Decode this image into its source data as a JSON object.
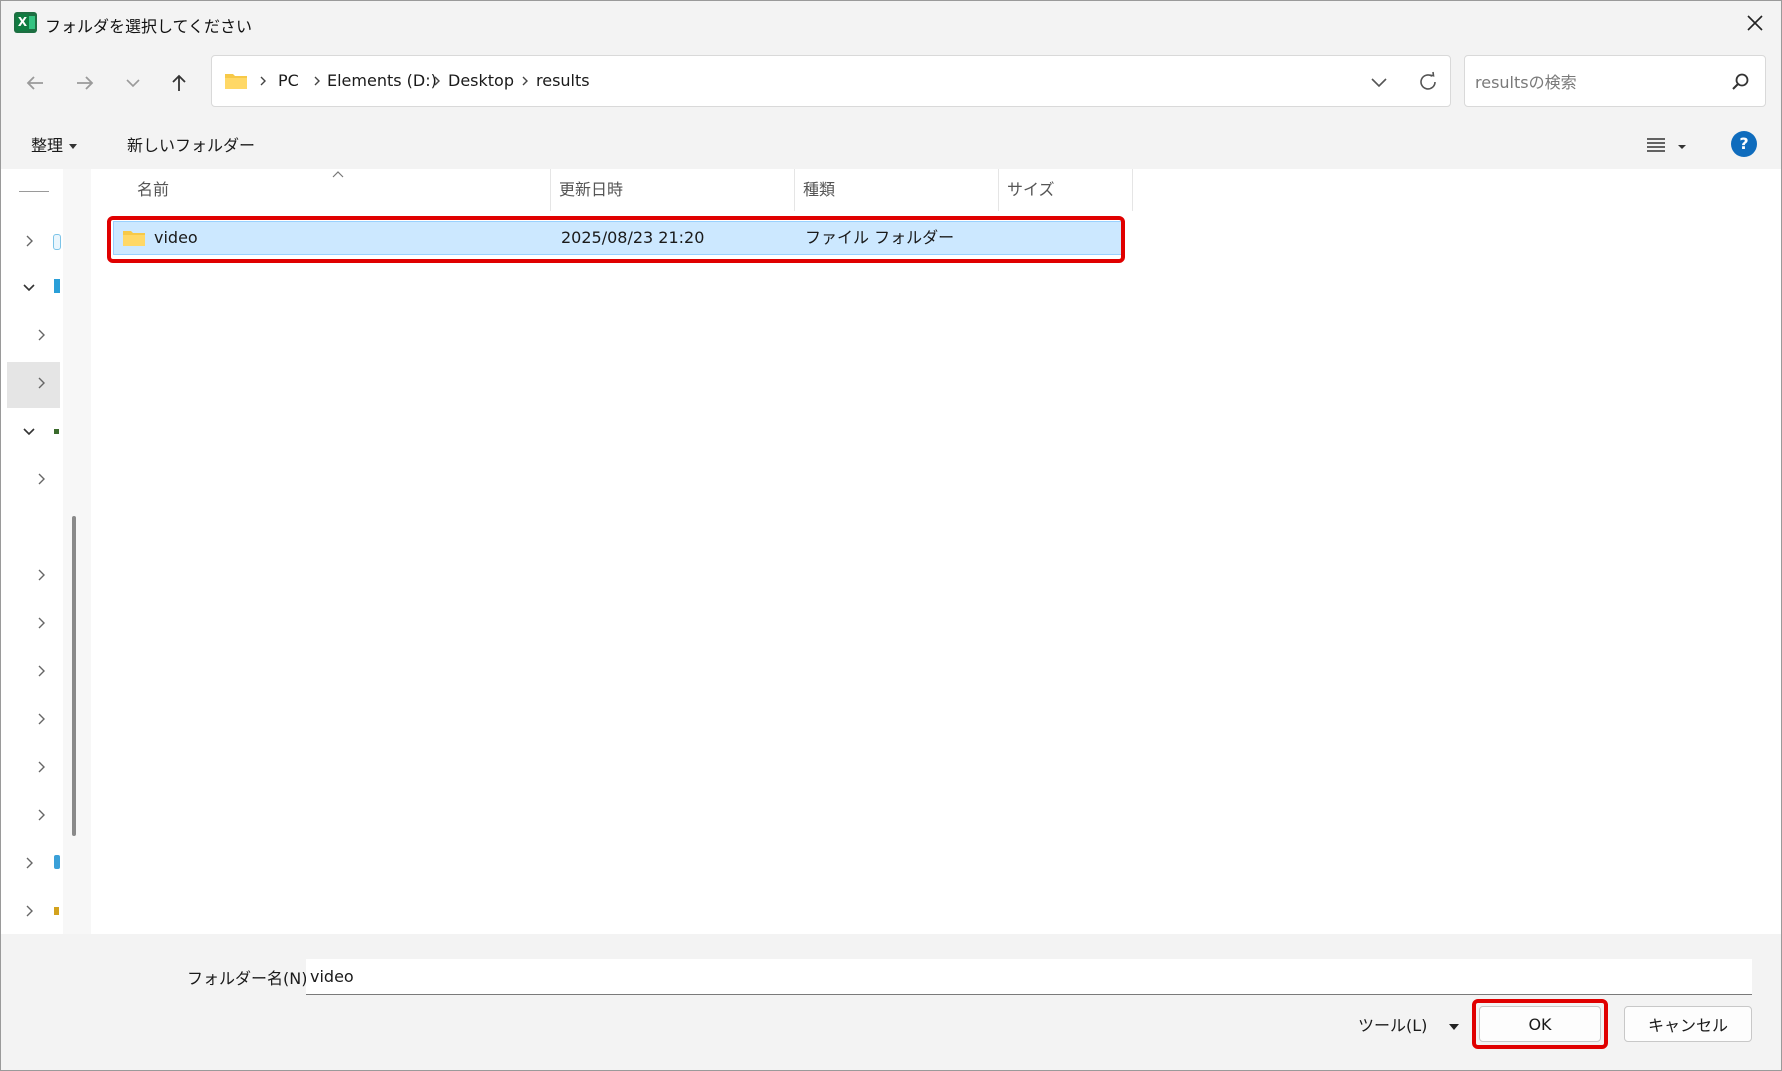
{
  "window": {
    "title": "フォルダを選択してください"
  },
  "breadcrumb": [
    "PC",
    "Elements (D:)",
    "Desktop",
    "results"
  ],
  "search": {
    "placeholder": "resultsの検索"
  },
  "commandbar": {
    "organize_label": "整理",
    "new_folder_label": "新しいフォルダー"
  },
  "columns": {
    "name": "名前",
    "modified": "更新日時",
    "type": "種類",
    "size": "サイズ"
  },
  "files": [
    {
      "name": "video",
      "modified": "2025/08/23 21:20",
      "type": "ファイル フォルダー",
      "size": ""
    }
  ],
  "footer": {
    "folder_name_label": "フォルダー名(N):",
    "folder_name_value": "video",
    "tools_label": "ツール(L)",
    "ok_label": "OK",
    "cancel_label": "キャンセル"
  },
  "help": {
    "label": "?"
  },
  "colors": {
    "accent": "#0f6cbd",
    "selection": "#cce8ff",
    "highlight": "#e00000"
  }
}
